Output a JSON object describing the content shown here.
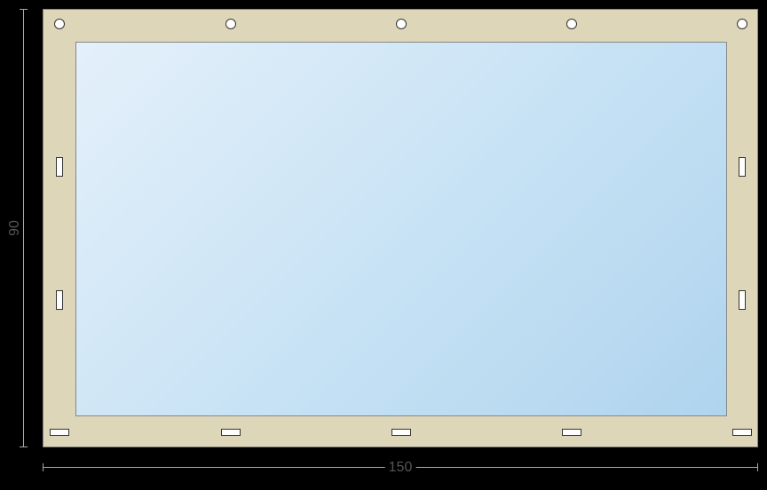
{
  "dimensions": {
    "width_label": "150",
    "height_label": "90"
  },
  "frame": {
    "color_beige": "#DDD6B8",
    "glass_gradient_start": "#E4F0FA",
    "glass_gradient_end": "#AFD4EE"
  },
  "holes": {
    "top_circles_count": 5,
    "side_vertical_slots_per_side": 2,
    "bottom_horizontal_slots_count": 5
  }
}
